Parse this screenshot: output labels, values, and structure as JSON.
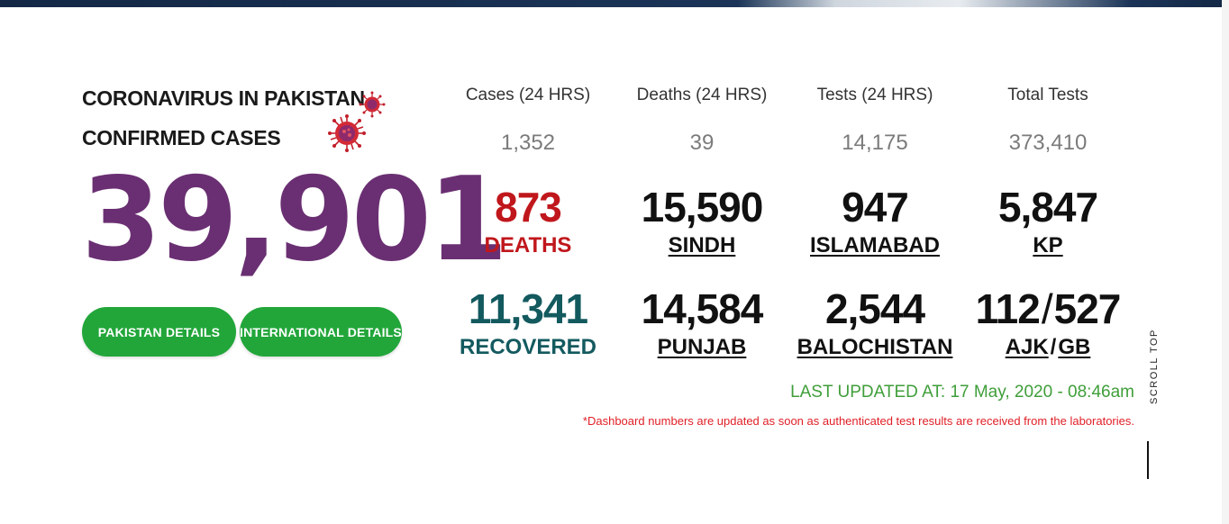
{
  "header": {
    "title_line1": "CORONAVIRUS IN PAKISTAN",
    "title_line2": "CONFIRMED CASES",
    "confirmed_total": "39,901"
  },
  "buttons": {
    "pakistan_details": "PAKISTAN DETAILS",
    "international_details": "INTERNATIONAL DETAILS"
  },
  "stats": {
    "columns": [
      {
        "header": "Cases (24 HRS)",
        "value": "1,352"
      },
      {
        "header": "Deaths (24 HRS)",
        "value": "39"
      },
      {
        "header": "Tests (24 HRS)",
        "value": "14,175"
      },
      {
        "header": "Total Tests",
        "value": "373,410"
      }
    ],
    "row1": [
      {
        "value": "873",
        "label": "DEATHS"
      },
      {
        "value": "15,590",
        "label": "SINDH"
      },
      {
        "value": "947",
        "label": "ISLAMABAD"
      },
      {
        "value": "5,847",
        "label": "KP"
      }
    ],
    "row2": [
      {
        "value": "11,341",
        "label": "RECOVERED"
      },
      {
        "value": "14,584",
        "label": "PUNJAB"
      },
      {
        "value": "2,544",
        "label": "BALOCHISTAN"
      },
      {
        "value_a": "112",
        "separator": "/",
        "value_b": "527",
        "label_a": "AJK",
        "label_sep": "/",
        "label_b": "GB"
      }
    ]
  },
  "footer": {
    "last_updated": "LAST UPDATED AT: 17 May, 2020 - 08:46am",
    "disclaimer": "*Dashboard numbers are updated as soon as authenticated test results are received from the laboratories."
  },
  "scroll_top": "SCROLL TOP",
  "colors": {
    "confirmed": "#6a2f72",
    "deaths": "#c0171c",
    "recovered": "#135a5f",
    "button": "#22a63a",
    "updated": "#3f9e3a",
    "disclaimer": "#e01f26"
  },
  "icons": [
    "coronavirus-icon"
  ]
}
